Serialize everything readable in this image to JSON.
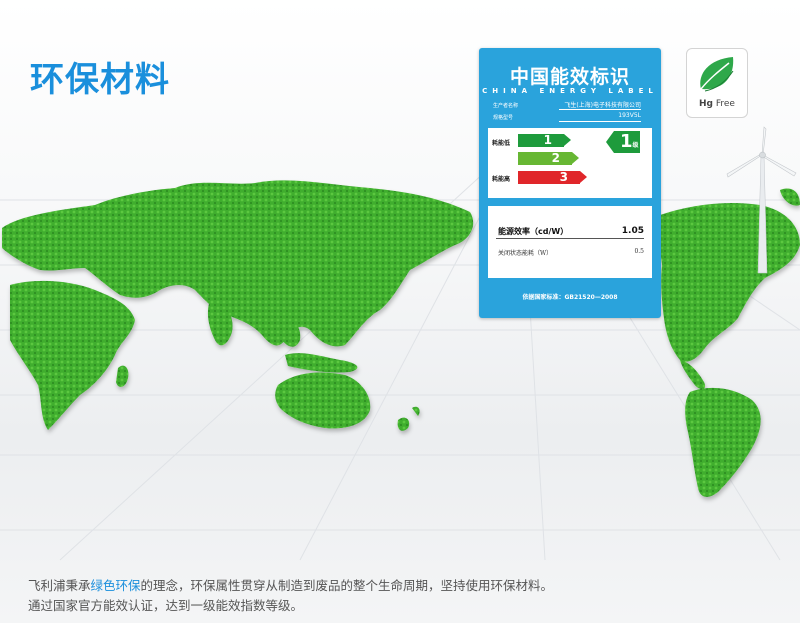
{
  "heading": "环保材料",
  "energy_label": {
    "title": "中国能效标识",
    "subtitle": "CHINA ENERGY LABEL",
    "manufacturer_key": "生产者名称",
    "manufacturer_value": "飞生(上海)电子科技有限公司",
    "model_key": "规格型号",
    "model_value": "193V5L",
    "low_label": "耗能低",
    "high_label": "耗能高",
    "grade_1": "1",
    "grade_2": "2",
    "grade_3": "3",
    "rating": "1",
    "rating_suffix": "级",
    "efficiency_key": "能源效率（cd/W）",
    "efficiency_value": "1.05",
    "standby_key": "关闭状态能耗（W）",
    "standby_value": "0.5",
    "standard": "依据国家标准：GB21520—2008",
    "colors": {
      "bg": "#2aa3dc",
      "grade1": "#1e9b3c",
      "grade2": "#67b733",
      "grade3": "#e0262a"
    }
  },
  "hg_badge": {
    "text_bold": "Hg",
    "text_rest": "Free",
    "icon": "leaf-icon"
  },
  "caption": {
    "line1_pre": "飞利浦秉承",
    "line1_highlight": "绿色环保",
    "line1_post": "的理念，环保属性贯穿从制造到废品的整个生命周期，坚持使用环保材料。",
    "line2": "通过国家官方能效认证，达到一级能效指数等级。"
  },
  "colors": {
    "accent": "#1a8fdc",
    "map_green": "#3fae2f"
  }
}
